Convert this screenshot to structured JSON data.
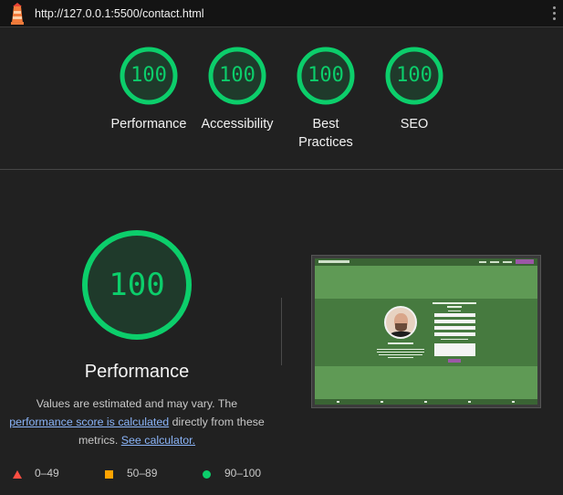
{
  "topbar": {
    "url": "http://127.0.0.1:5500/contact.html",
    "logo_icon": "lighthouse-icon",
    "menu_icon": "kebab-menu-icon"
  },
  "colors": {
    "pass": "#0cce6b",
    "average": "#ffa400",
    "fail": "#ff4e42",
    "background": "#212121",
    "link": "#8ab4f8"
  },
  "scores": [
    {
      "label_line1": "Performance",
      "label_line2": "",
      "score": "100"
    },
    {
      "label_line1": "Accessibility",
      "label_line2": "",
      "score": "100"
    },
    {
      "label_line1": "Best",
      "label_line2": "Practices",
      "score": "100"
    },
    {
      "label_line1": "SEO",
      "label_line2": "",
      "score": "100"
    }
  ],
  "main": {
    "score": "100",
    "title": "Performance",
    "desc_text1": "Values are estimated and may vary. The",
    "desc_link1": "performance score is calculated",
    "desc_text2": "directly from these metrics.",
    "desc_link2": "See calculator."
  },
  "screenshot": {
    "heading": "PLEASE TELL ME HERE YOU ARE",
    "subheading": "CONTACT ME"
  },
  "legend": [
    {
      "shape": "triangle",
      "range": "0–49"
    },
    {
      "shape": "square",
      "range": "50–89"
    },
    {
      "shape": "circle",
      "range": "90–100"
    }
  ]
}
